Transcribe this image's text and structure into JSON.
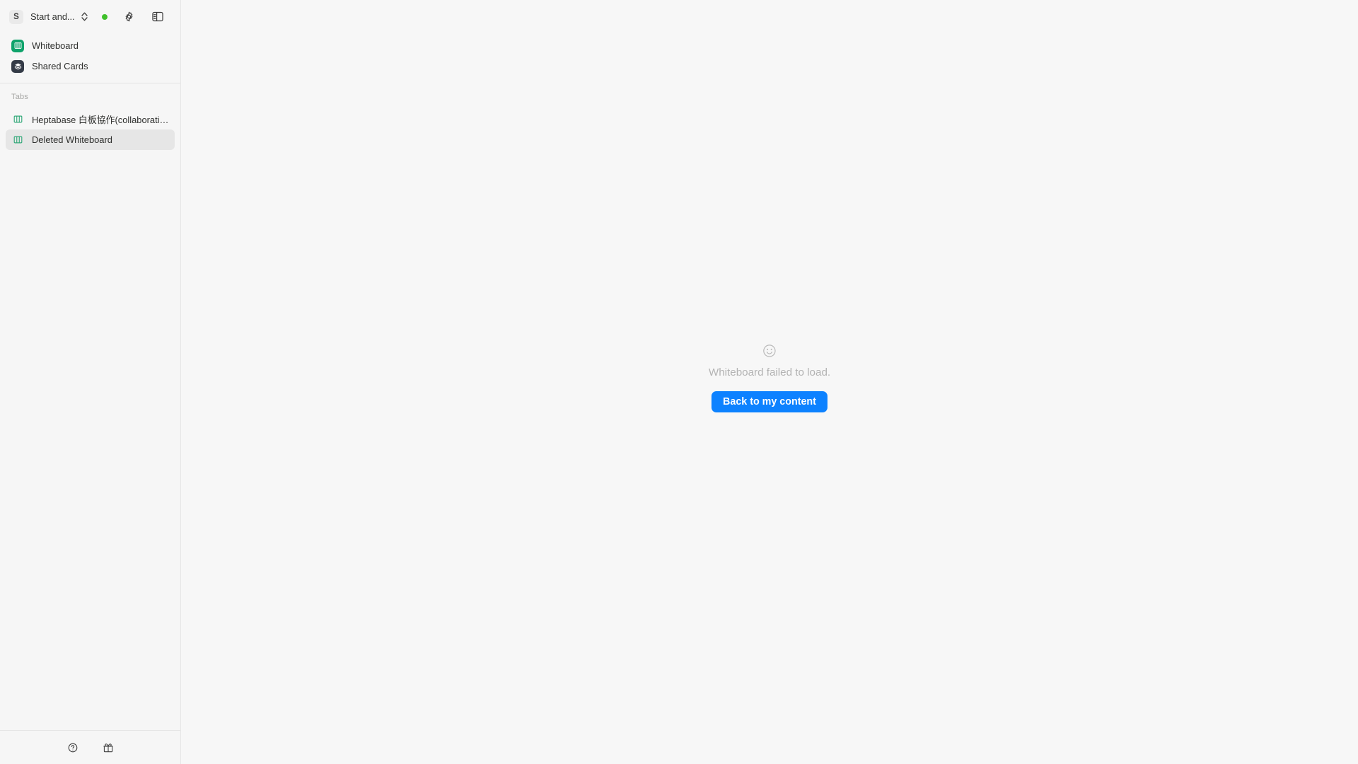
{
  "sidebar": {
    "workspace": {
      "avatar_initial": "S",
      "name": "Start and...",
      "chevron_icon": "chevron-up-down-icon",
      "status_dot_color": "#3fc02b",
      "settings_icon": "gear-icon",
      "panel_toggle_icon": "sidebar-toggle-icon"
    },
    "nav_items": [
      {
        "label": "Whiteboard",
        "icon": "whiteboard-icon",
        "icon_color": "#0fa36b"
      },
      {
        "label": "Shared Cards",
        "icon": "layers-icon",
        "icon_color": "#343b47"
      }
    ],
    "tabs_section": {
      "heading": "Tabs",
      "items": [
        {
          "label": "Heptabase 白板協作(collaboration)",
          "icon": "whiteboard-outline-icon",
          "selected": false
        },
        {
          "label": "Deleted Whiteboard",
          "icon": "whiteboard-outline-icon",
          "selected": true
        }
      ]
    },
    "footer": {
      "help_icon": "question-circle-icon",
      "gift_icon": "gift-icon"
    }
  },
  "main": {
    "empty_state": {
      "icon": "smiley-face-icon",
      "message": "Whiteboard failed to load.",
      "button_label": "Back to my content",
      "button_color": "#0d82ff"
    }
  }
}
